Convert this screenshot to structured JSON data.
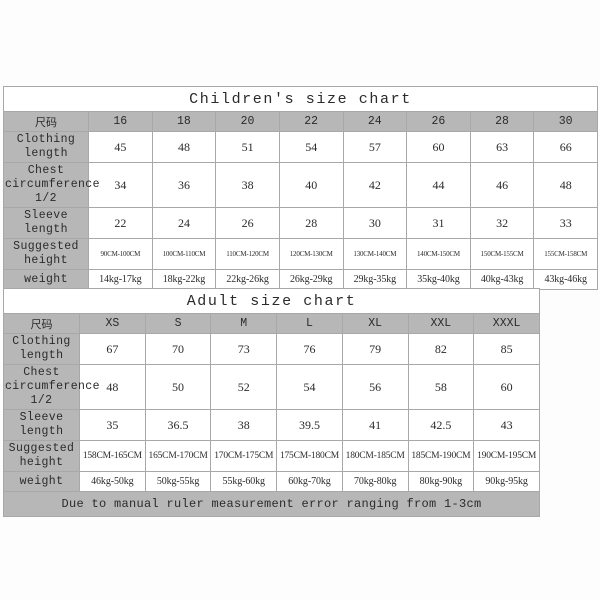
{
  "children": {
    "title": "Children's size chart",
    "size_label": "尺码",
    "sizes": [
      "16",
      "18",
      "20",
      "22",
      "24",
      "26",
      "28",
      "30"
    ],
    "rows": [
      {
        "label": "Clothing length",
        "values": [
          "45",
          "48",
          "51",
          "54",
          "57",
          "60",
          "63",
          "66"
        ]
      },
      {
        "label": "Chest circumference 1/2",
        "values": [
          "34",
          "36",
          "38",
          "40",
          "42",
          "44",
          "46",
          "48"
        ]
      },
      {
        "label": "Sleeve length",
        "values": [
          "22",
          "24",
          "26",
          "28",
          "30",
          "31",
          "32",
          "33"
        ]
      },
      {
        "label": "Suggested height",
        "values": [
          "90CM-100CM",
          "100CM-110CM",
          "110CM-120CM",
          "120CM-130CM",
          "130CM-140CM",
          "140CM-150CM",
          "150CM-155CM",
          "155CM-158CM"
        ]
      },
      {
        "label": "weight",
        "values": [
          "14kg-17kg",
          "18kg-22kg",
          "22kg-26kg",
          "26kg-29kg",
          "29kg-35kg",
          "35kg-40kg",
          "40kg-43kg",
          "43kg-46kg"
        ]
      }
    ]
  },
  "adult": {
    "title": "Adult size chart",
    "size_label": "尺码",
    "sizes": [
      "XS",
      "S",
      "M",
      "L",
      "XL",
      "XXL",
      "XXXL"
    ],
    "rows": [
      {
        "label": "Clothing length",
        "values": [
          "67",
          "70",
          "73",
          "76",
          "79",
          "82",
          "85"
        ]
      },
      {
        "label": "Chest circumference 1/2",
        "values": [
          "48",
          "50",
          "52",
          "54",
          "56",
          "58",
          "60"
        ]
      },
      {
        "label": "Sleeve length",
        "values": [
          "35",
          "36.5",
          "38",
          "39.5",
          "41",
          "42.5",
          "43"
        ]
      },
      {
        "label": "Suggested height",
        "values": [
          "158CM-165CM",
          "165CM-170CM",
          "170CM-175CM",
          "175CM-180CM",
          "180CM-185CM",
          "185CM-190CM",
          "190CM-195CM"
        ]
      },
      {
        "label": "weight",
        "values": [
          "46kg-50kg",
          "50kg-55kg",
          "55kg-60kg",
          "60kg-70kg",
          "70kg-80kg",
          "80kg-90kg",
          "90kg-95kg"
        ]
      }
    ],
    "note": "Due to manual ruler measurement error ranging from 1-3cm"
  },
  "colors": {
    "header_gray": "#b7b7b7",
    "cell_white": "#ffffff",
    "border": "#a8a8a8",
    "page_bg": "#fdfdfd",
    "text": "#2b2b2b"
  }
}
